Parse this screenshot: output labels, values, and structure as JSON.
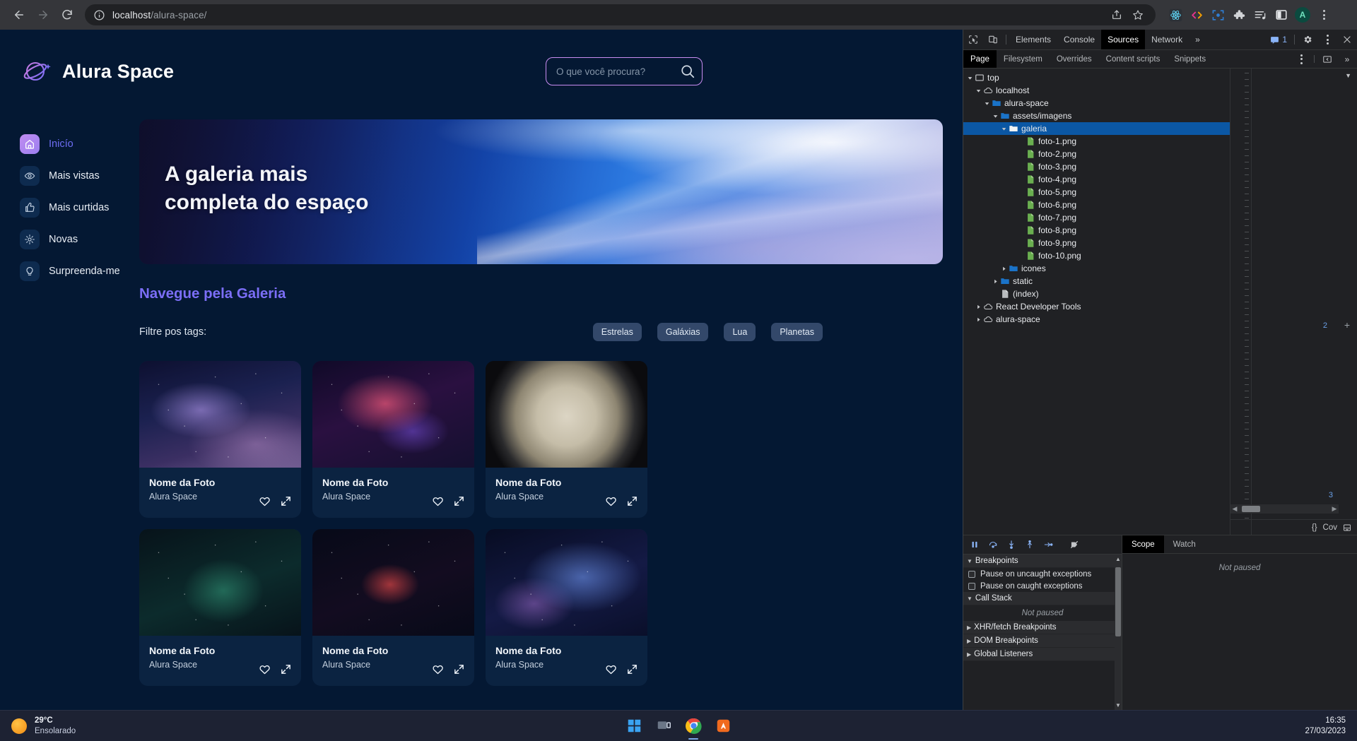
{
  "browser": {
    "back_label": "Back",
    "forward_label": "Forward",
    "reload_label": "Reload",
    "url_host": "localhost",
    "url_path": "/alura-space/",
    "share_label": "Share this page",
    "bookmark_label": "Bookmark this tab",
    "profile_initial": "A",
    "extensions": [
      "react-devtools-icon",
      "code-extension-icon",
      "scanner-extension-icon",
      "puzzle-extensions-icon",
      "reading-list-icon",
      "side-panel-icon"
    ]
  },
  "site": {
    "logo_text": "Alura Space",
    "search": {
      "placeholder": "O que você procura?",
      "value": ""
    },
    "sidebar": [
      {
        "label": "Inicío",
        "icon": "home-icon",
        "active": true
      },
      {
        "label": "Mais vistas",
        "icon": "eye-icon",
        "active": false
      },
      {
        "label": "Mais curtidas",
        "icon": "thumbs-up-icon",
        "active": false
      },
      {
        "label": "Novas",
        "icon": "sparkle-icon",
        "active": false
      },
      {
        "label": "Surpreenda-me",
        "icon": "bulb-icon",
        "active": false
      }
    ],
    "banner": {
      "line1": "A galeria mais",
      "line2": "completa do espaço"
    },
    "gallery_title": "Navegue pela Galeria",
    "filter_label": "Filtre pos tags:",
    "tags": [
      "Estrelas",
      "Galáxias",
      "Lua",
      "Planetas"
    ],
    "cards": [
      {
        "name": "Nome da Foto",
        "author": "Alura Space",
        "art": "art-a"
      },
      {
        "name": "Nome da Foto",
        "author": "Alura Space",
        "art": "art-b"
      },
      {
        "name": "Nome da Foto",
        "author": "Alura Space",
        "art": "art-c"
      },
      {
        "name": "Nome da Foto",
        "author": "Alura Space",
        "art": "art-d"
      },
      {
        "name": "Nome da Foto",
        "author": "Alura Space",
        "art": "art-e"
      },
      {
        "name": "Nome da Foto",
        "author": "Alura Space",
        "art": "art-f"
      }
    ],
    "card_actions": {
      "favorite": "heart-icon",
      "expand": "expand-icon"
    }
  },
  "devtools": {
    "tabs": [
      "Elements",
      "Console",
      "Sources",
      "Network"
    ],
    "selected_tab": "Sources",
    "overflow_label": "»",
    "message_count": "1",
    "settings_label": "Settings",
    "more_label": "Customize and control DevTools",
    "close_label": "Close DevTools",
    "subtabs": [
      "Page",
      "Filesystem",
      "Overrides",
      "Content scripts",
      "Snippets"
    ],
    "selected_subtab": "Page",
    "tree": [
      {
        "label": "top",
        "depth": 0,
        "icon": "frame-icon",
        "state": "open",
        "selected": false
      },
      {
        "label": "localhost",
        "depth": 1,
        "icon": "cloud-icon",
        "state": "open",
        "selected": false
      },
      {
        "label": "alura-space",
        "depth": 2,
        "icon": "folder-icon",
        "state": "open",
        "selected": false
      },
      {
        "label": "assets/imagens",
        "depth": 3,
        "icon": "folder-icon",
        "state": "open",
        "selected": false
      },
      {
        "label": "galeria",
        "depth": 4,
        "icon": "folder-icon",
        "state": "open",
        "selected": true
      },
      {
        "label": "foto-1.png",
        "depth": 6,
        "icon": "image-file-icon",
        "state": "none",
        "selected": false
      },
      {
        "label": "foto-2.png",
        "depth": 6,
        "icon": "image-file-icon",
        "state": "none",
        "selected": false
      },
      {
        "label": "foto-3.png",
        "depth": 6,
        "icon": "image-file-icon",
        "state": "none",
        "selected": false
      },
      {
        "label": "foto-4.png",
        "depth": 6,
        "icon": "image-file-icon",
        "state": "none",
        "selected": false
      },
      {
        "label": "foto-5.png",
        "depth": 6,
        "icon": "image-file-icon",
        "state": "none",
        "selected": false
      },
      {
        "label": "foto-6.png",
        "depth": 6,
        "icon": "image-file-icon",
        "state": "none",
        "selected": false
      },
      {
        "label": "foto-7.png",
        "depth": 6,
        "icon": "image-file-icon",
        "state": "none",
        "selected": false
      },
      {
        "label": "foto-8.png",
        "depth": 6,
        "icon": "image-file-icon",
        "state": "none",
        "selected": false
      },
      {
        "label": "foto-9.png",
        "depth": 6,
        "icon": "image-file-icon",
        "state": "none",
        "selected": false
      },
      {
        "label": "foto-10.png",
        "depth": 6,
        "icon": "image-file-icon",
        "state": "none",
        "selected": false
      },
      {
        "label": "icones",
        "depth": 4,
        "icon": "folder-icon",
        "state": "closed",
        "selected": false
      },
      {
        "label": "static",
        "depth": 3,
        "icon": "folder-icon",
        "state": "closed",
        "selected": false
      },
      {
        "label": "(index)",
        "depth": 3,
        "icon": "doc-file-icon",
        "state": "none",
        "selected": false
      },
      {
        "label": "React Developer Tools",
        "depth": 1,
        "icon": "cloud-icon",
        "state": "closed",
        "selected": false
      },
      {
        "label": "alura-space",
        "depth": 1,
        "icon": "cloud-icon",
        "state": "closed",
        "selected": false
      }
    ],
    "editor_line_marker": "2",
    "editor_line_marker2": "3",
    "status": {
      "format": "{}",
      "coverage": "Cov"
    },
    "debugger": {
      "controls": [
        "pause-icon",
        "step-over-icon",
        "step-into-icon",
        "step-out-icon",
        "step-icon",
        "deactivate-breakpoints-icon"
      ],
      "sections": [
        {
          "title": "Breakpoints",
          "state": "open"
        },
        {
          "title": "Call Stack",
          "state": "open"
        },
        {
          "title": "XHR/fetch Breakpoints",
          "state": "closed"
        },
        {
          "title": "DOM Breakpoints",
          "state": "closed"
        },
        {
          "title": "Global Listeners",
          "state": "closed"
        }
      ],
      "checkboxes": [
        "Pause on uncaught exceptions",
        "Pause on caught exceptions"
      ],
      "callstack_status": "Not paused",
      "scope_tabs": [
        "Scope",
        "Watch"
      ],
      "scope_selected": "Scope",
      "scope_status": "Not paused"
    }
  },
  "taskbar": {
    "weather_temp": "29°C",
    "weather_desc": "Ensolarado",
    "apps": [
      "windows-start-icon",
      "task-view-icon",
      "chrome-icon",
      "app-orange-icon"
    ],
    "time": "16:35",
    "date": "27/03/2023"
  }
}
